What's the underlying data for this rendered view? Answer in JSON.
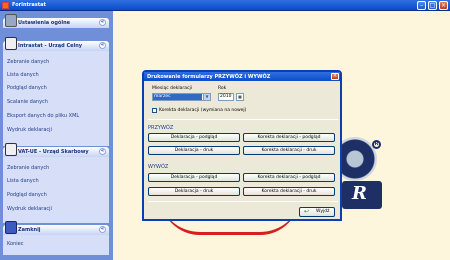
{
  "window": {
    "title": "ForIntrastat",
    "minimize": "–",
    "maximize": "□",
    "close": "×"
  },
  "sidebar": {
    "panels": [
      {
        "title": "Ustawienia ogólne",
        "chevron": "«",
        "items": []
      },
      {
        "title": "Intrastat - Urząd Celny",
        "chevron": "«",
        "items": [
          "Zebranie danych",
          "Lista danych",
          "Podgląd danych",
          "Scalanie danych",
          "Eksport danych do pliku XML",
          "Wydruk deklaracji"
        ]
      },
      {
        "title": "VAT-UE - Urząd Skarbowy",
        "chevron": "«",
        "items": [
          "Zebranie danych",
          "Lista danych",
          "Podgląd danych",
          "Wydruk deklaracji"
        ]
      },
      {
        "title": "Zamknij",
        "chevron": "«",
        "items": [
          "Koniec"
        ]
      }
    ]
  },
  "dialog": {
    "title": "Drukowanie formularzy PRZYWÓZ i WYWÓZ",
    "close": "×",
    "month_label": "Miesiąc deklaracji",
    "month_value": "marzec",
    "year_label": "Rok",
    "year_value": "2010",
    "checkbox_label": "Korekta deklaracji (wymiana na nowej)",
    "sections": [
      {
        "title": "PRZYWÓZ",
        "buttons": [
          "Deklaracja - podgląd",
          "Korekta deklaracji - podgląd",
          "Deklaracja - druk",
          "Korekta deklaracji - druk"
        ]
      },
      {
        "title": "WYWÓZ",
        "buttons": [
          "Deklaracja - podgląd",
          "Korekta deklaracji - podgląd",
          "Deklaracja - druk",
          "Korekta deklaracji - druk"
        ]
      }
    ],
    "close_button": "Wyjdź"
  },
  "logo": {
    "text": "R",
    "registered": "R"
  }
}
